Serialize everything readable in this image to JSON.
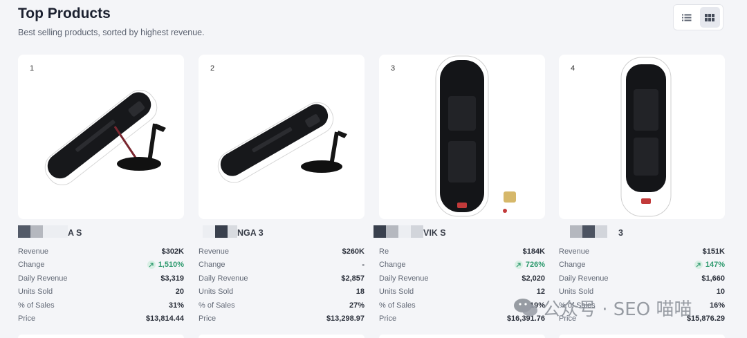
{
  "header": {
    "title": "Top Products",
    "subtitle": "Best selling products, sorted by highest revenue."
  },
  "view_toggle": {
    "list_icon": "list-icon",
    "grid_icon": "grid-icon",
    "active": "grid"
  },
  "stat_labels": {
    "revenue": "Revenue",
    "change": "Change",
    "daily_revenue": "Daily Revenue",
    "units_sold": "Units Sold",
    "pct_sales": "% of Sales",
    "price": "Price"
  },
  "products": [
    {
      "rank": "1",
      "name": "A S",
      "revenue_label": "Revenue",
      "revenue": "$302K",
      "change": "1,510%",
      "change_dir": "up",
      "daily_revenue": "$3,319",
      "units_sold": "20",
      "pct_sales": "31%",
      "price": "$13,814.44"
    },
    {
      "rank": "2",
      "name": "NGA 3",
      "revenue_label": "Revenue",
      "revenue": "$260K",
      "change": "-",
      "change_dir": "none",
      "daily_revenue": "$2,857",
      "units_sold": "18",
      "pct_sales": "27%",
      "price": "$13,298.97"
    },
    {
      "rank": "3",
      "name": "VIK S",
      "revenue_label": "Re",
      "revenue": "$184K",
      "change": "726%",
      "change_dir": "up",
      "daily_revenue": "$2,020",
      "units_sold": "12",
      "pct_sales": "19%",
      "price": "$16,391.76"
    },
    {
      "rank": "4",
      "name": "3",
      "revenue_label": "Revenue",
      "revenue": "$151K",
      "change": "147%",
      "change_dir": "up",
      "daily_revenue": "$1,660",
      "units_sold": "10",
      "pct_sales": "16%",
      "price": "$15,876.29"
    }
  ],
  "watermark": {
    "text": "公众号 · SEO 喵喵"
  },
  "colors": {
    "positive": "#2e9a6e",
    "background": "#f4f5f8",
    "card": "#ffffff"
  }
}
